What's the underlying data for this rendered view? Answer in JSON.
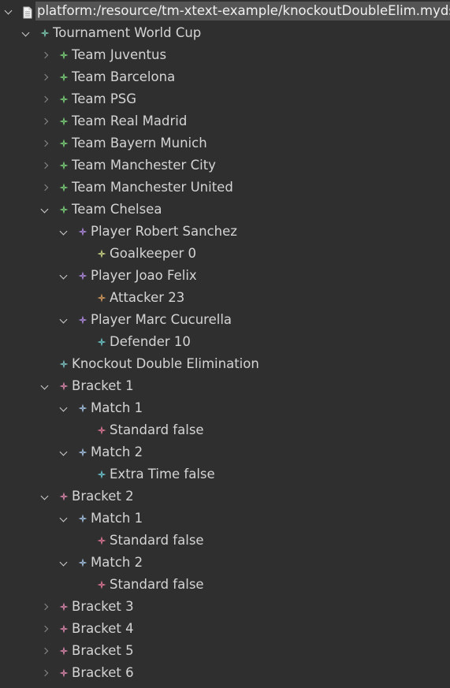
{
  "tree": {
    "root": {
      "label": "platform:/resource/tm-xtext-example/knockoutDoubleElim.mydsl",
      "icon": "file-icon"
    },
    "nodes": [
      {
        "label": "Tournament World Cup",
        "depth": 1,
        "state": "expanded",
        "icon": "node-icon",
        "color": "#7fd1b9"
      },
      {
        "label": "Team Juventus",
        "depth": 2,
        "state": "collapsed",
        "icon": "node-icon",
        "color": "#7dd87d"
      },
      {
        "label": "Team Barcelona",
        "depth": 2,
        "state": "collapsed",
        "icon": "node-icon",
        "color": "#7dd87d"
      },
      {
        "label": "Team PSG",
        "depth": 2,
        "state": "collapsed",
        "icon": "node-icon",
        "color": "#7dd87d"
      },
      {
        "label": "Team Real Madrid",
        "depth": 2,
        "state": "collapsed",
        "icon": "node-icon",
        "color": "#7dd87d"
      },
      {
        "label": "Team Bayern Munich",
        "depth": 2,
        "state": "collapsed",
        "icon": "node-icon",
        "color": "#7dd87d"
      },
      {
        "label": "Team Manchester City",
        "depth": 2,
        "state": "collapsed",
        "icon": "node-icon",
        "color": "#7dd87d"
      },
      {
        "label": "Team Manchester United",
        "depth": 2,
        "state": "collapsed",
        "icon": "node-icon",
        "color": "#7dd87d"
      },
      {
        "label": "Team Chelsea",
        "depth": 2,
        "state": "expanded",
        "icon": "node-icon",
        "color": "#7dd87d"
      },
      {
        "label": "Player Robert Sanchez",
        "depth": 3,
        "state": "expanded",
        "icon": "node-icon",
        "color": "#b48ce6"
      },
      {
        "label": "Goalkeeper 0",
        "depth": 4,
        "state": "leaf",
        "icon": "node-icon",
        "color": "#d6e08a"
      },
      {
        "label": "Player Joao Felix",
        "depth": 3,
        "state": "expanded",
        "icon": "node-icon",
        "color": "#b48ce6"
      },
      {
        "label": "Attacker 23",
        "depth": 4,
        "state": "leaf",
        "icon": "node-icon",
        "color": "#e0a060"
      },
      {
        "label": "Player Marc Cucurella",
        "depth": 3,
        "state": "expanded",
        "icon": "node-icon",
        "color": "#b48ce6"
      },
      {
        "label": "Defender 10",
        "depth": 4,
        "state": "leaf",
        "icon": "node-icon",
        "color": "#6fcfcf"
      },
      {
        "label": "Knockout Double Elimination",
        "depth": 2,
        "state": "leaf",
        "icon": "node-icon",
        "color": "#7fc8c8"
      },
      {
        "label": "Bracket 1",
        "depth": 2,
        "state": "expanded",
        "icon": "node-icon",
        "color": "#e08ab0"
      },
      {
        "label": "Match 1",
        "depth": 3,
        "state": "expanded",
        "icon": "node-icon",
        "color": "#a8c8e8"
      },
      {
        "label": "Standard false",
        "depth": 4,
        "state": "leaf",
        "icon": "node-icon",
        "color": "#e87a9a"
      },
      {
        "label": "Match 2",
        "depth": 3,
        "state": "expanded",
        "icon": "node-icon",
        "color": "#a8c8e8"
      },
      {
        "label": "Extra Time false",
        "depth": 4,
        "state": "leaf",
        "icon": "node-icon",
        "color": "#6fcfd8"
      },
      {
        "label": "Bracket 2",
        "depth": 2,
        "state": "expanded",
        "icon": "node-icon",
        "color": "#e08ab0"
      },
      {
        "label": "Match 1",
        "depth": 3,
        "state": "expanded",
        "icon": "node-icon",
        "color": "#a8c8e8"
      },
      {
        "label": "Standard false",
        "depth": 4,
        "state": "leaf",
        "icon": "node-icon",
        "color": "#e87a9a"
      },
      {
        "label": "Match 2",
        "depth": 3,
        "state": "expanded",
        "icon": "node-icon",
        "color": "#a8c8e8"
      },
      {
        "label": "Standard false",
        "depth": 4,
        "state": "leaf",
        "icon": "node-icon",
        "color": "#e87a9a"
      },
      {
        "label": "Bracket 3",
        "depth": 2,
        "state": "collapsed",
        "icon": "node-icon",
        "color": "#e08ab0"
      },
      {
        "label": "Bracket 4",
        "depth": 2,
        "state": "collapsed",
        "icon": "node-icon",
        "color": "#e08ab0"
      },
      {
        "label": "Bracket 5",
        "depth": 2,
        "state": "collapsed",
        "icon": "node-icon",
        "color": "#e08ab0"
      },
      {
        "label": "Bracket 6",
        "depth": 2,
        "state": "collapsed",
        "icon": "node-icon",
        "color": "#e08ab0"
      }
    ]
  },
  "colors": {
    "background": "#2f2f2f",
    "selection": "#545454",
    "text": "#d4d4d4"
  }
}
